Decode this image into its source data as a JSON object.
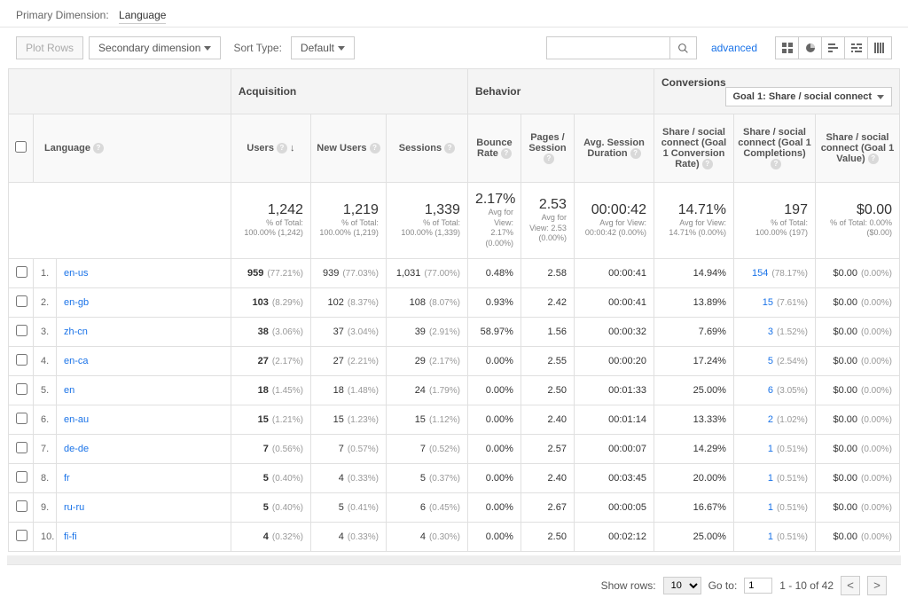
{
  "primary_dimension_label": "Primary Dimension:",
  "primary_dimension_value": "Language",
  "toolbar": {
    "plot_rows": "Plot Rows",
    "secondary_dimension": "Secondary dimension",
    "sort_type_label": "Sort Type:",
    "sort_type_value": "Default",
    "advanced": "advanced"
  },
  "groups": {
    "acquisition": "Acquisition",
    "behavior": "Behavior",
    "conversions": "Conversions",
    "goal_select": "Goal 1: Share / social connect"
  },
  "columns": {
    "language": "Language",
    "users": "Users",
    "new_users": "New Users",
    "sessions": "Sessions",
    "bounce_rate": "Bounce Rate",
    "pages_session": "Pages / Session",
    "avg_duration": "Avg. Session Duration",
    "conv_rate": "Share / social connect (Goal 1 Conversion Rate)",
    "completions": "Share / social connect (Goal 1 Completions)",
    "value": "Share / social connect (Goal 1 Value)"
  },
  "summary": {
    "users": {
      "big": "1,242",
      "sm": "% of Total: 100.00% (1,242)"
    },
    "new_users": {
      "big": "1,219",
      "sm": "% of Total: 100.00% (1,219)"
    },
    "sessions": {
      "big": "1,339",
      "sm": "% of Total: 100.00% (1,339)"
    },
    "bounce": {
      "big": "2.17%",
      "sm": "Avg for View: 2.17% (0.00%)"
    },
    "pps": {
      "big": "2.53",
      "sm": "Avg for View: 2.53 (0.00%)"
    },
    "asd": {
      "big": "00:00:42",
      "sm": "Avg for View: 00:00:42 (0.00%)"
    },
    "cr": {
      "big": "14.71%",
      "sm": "Avg for View: 14.71% (0.00%)"
    },
    "cc": {
      "big": "197",
      "sm": "% of Total: 100.00% (197)"
    },
    "cv": {
      "big": "$0.00",
      "sm": "% of Total: 0.00% ($0.00)"
    }
  },
  "rows": [
    {
      "idx": "1.",
      "lang": "en-us",
      "u": "959",
      "up": "(77.21%)",
      "nu": "939",
      "nup": "(77.03%)",
      "s": "1,031",
      "sp": "(77.00%)",
      "br": "0.48%",
      "pps": "2.58",
      "asd": "00:00:41",
      "cr": "14.94%",
      "cc": "154",
      "ccp": "(78.17%)",
      "cv": "$0.00",
      "cvp": "(0.00%)"
    },
    {
      "idx": "2.",
      "lang": "en-gb",
      "u": "103",
      "up": "(8.29%)",
      "nu": "102",
      "nup": "(8.37%)",
      "s": "108",
      "sp": "(8.07%)",
      "br": "0.93%",
      "pps": "2.42",
      "asd": "00:00:41",
      "cr": "13.89%",
      "cc": "15",
      "ccp": "(7.61%)",
      "cv": "$0.00",
      "cvp": "(0.00%)"
    },
    {
      "idx": "3.",
      "lang": "zh-cn",
      "u": "38",
      "up": "(3.06%)",
      "nu": "37",
      "nup": "(3.04%)",
      "s": "39",
      "sp": "(2.91%)",
      "br": "58.97%",
      "pps": "1.56",
      "asd": "00:00:32",
      "cr": "7.69%",
      "cc": "3",
      "ccp": "(1.52%)",
      "cv": "$0.00",
      "cvp": "(0.00%)"
    },
    {
      "idx": "4.",
      "lang": "en-ca",
      "u": "27",
      "up": "(2.17%)",
      "nu": "27",
      "nup": "(2.21%)",
      "s": "29",
      "sp": "(2.17%)",
      "br": "0.00%",
      "pps": "2.55",
      "asd": "00:00:20",
      "cr": "17.24%",
      "cc": "5",
      "ccp": "(2.54%)",
      "cv": "$0.00",
      "cvp": "(0.00%)"
    },
    {
      "idx": "5.",
      "lang": "en",
      "u": "18",
      "up": "(1.45%)",
      "nu": "18",
      "nup": "(1.48%)",
      "s": "24",
      "sp": "(1.79%)",
      "br": "0.00%",
      "pps": "2.50",
      "asd": "00:01:33",
      "cr": "25.00%",
      "cc": "6",
      "ccp": "(3.05%)",
      "cv": "$0.00",
      "cvp": "(0.00%)"
    },
    {
      "idx": "6.",
      "lang": "en-au",
      "u": "15",
      "up": "(1.21%)",
      "nu": "15",
      "nup": "(1.23%)",
      "s": "15",
      "sp": "(1.12%)",
      "br": "0.00%",
      "pps": "2.40",
      "asd": "00:01:14",
      "cr": "13.33%",
      "cc": "2",
      "ccp": "(1.02%)",
      "cv": "$0.00",
      "cvp": "(0.00%)"
    },
    {
      "idx": "7.",
      "lang": "de-de",
      "u": "7",
      "up": "(0.56%)",
      "nu": "7",
      "nup": "(0.57%)",
      "s": "7",
      "sp": "(0.52%)",
      "br": "0.00%",
      "pps": "2.57",
      "asd": "00:00:07",
      "cr": "14.29%",
      "cc": "1",
      "ccp": "(0.51%)",
      "cv": "$0.00",
      "cvp": "(0.00%)"
    },
    {
      "idx": "8.",
      "lang": "fr",
      "u": "5",
      "up": "(0.40%)",
      "nu": "4",
      "nup": "(0.33%)",
      "s": "5",
      "sp": "(0.37%)",
      "br": "0.00%",
      "pps": "2.40",
      "asd": "00:03:45",
      "cr": "20.00%",
      "cc": "1",
      "ccp": "(0.51%)",
      "cv": "$0.00",
      "cvp": "(0.00%)"
    },
    {
      "idx": "9.",
      "lang": "ru-ru",
      "u": "5",
      "up": "(0.40%)",
      "nu": "5",
      "nup": "(0.41%)",
      "s": "6",
      "sp": "(0.45%)",
      "br": "0.00%",
      "pps": "2.67",
      "asd": "00:00:05",
      "cr": "16.67%",
      "cc": "1",
      "ccp": "(0.51%)",
      "cv": "$0.00",
      "cvp": "(0.00%)"
    },
    {
      "idx": "10.",
      "lang": "fi-fi",
      "u": "4",
      "up": "(0.32%)",
      "nu": "4",
      "nup": "(0.33%)",
      "s": "4",
      "sp": "(0.30%)",
      "br": "0.00%",
      "pps": "2.50",
      "asd": "00:02:12",
      "cr": "25.00%",
      "cc": "1",
      "ccp": "(0.51%)",
      "cv": "$0.00",
      "cvp": "(0.00%)"
    }
  ],
  "footer": {
    "show_rows": "Show rows:",
    "rows_value": "10",
    "go_to": "Go to:",
    "go_value": "1",
    "range": "1 - 10 of 42"
  }
}
